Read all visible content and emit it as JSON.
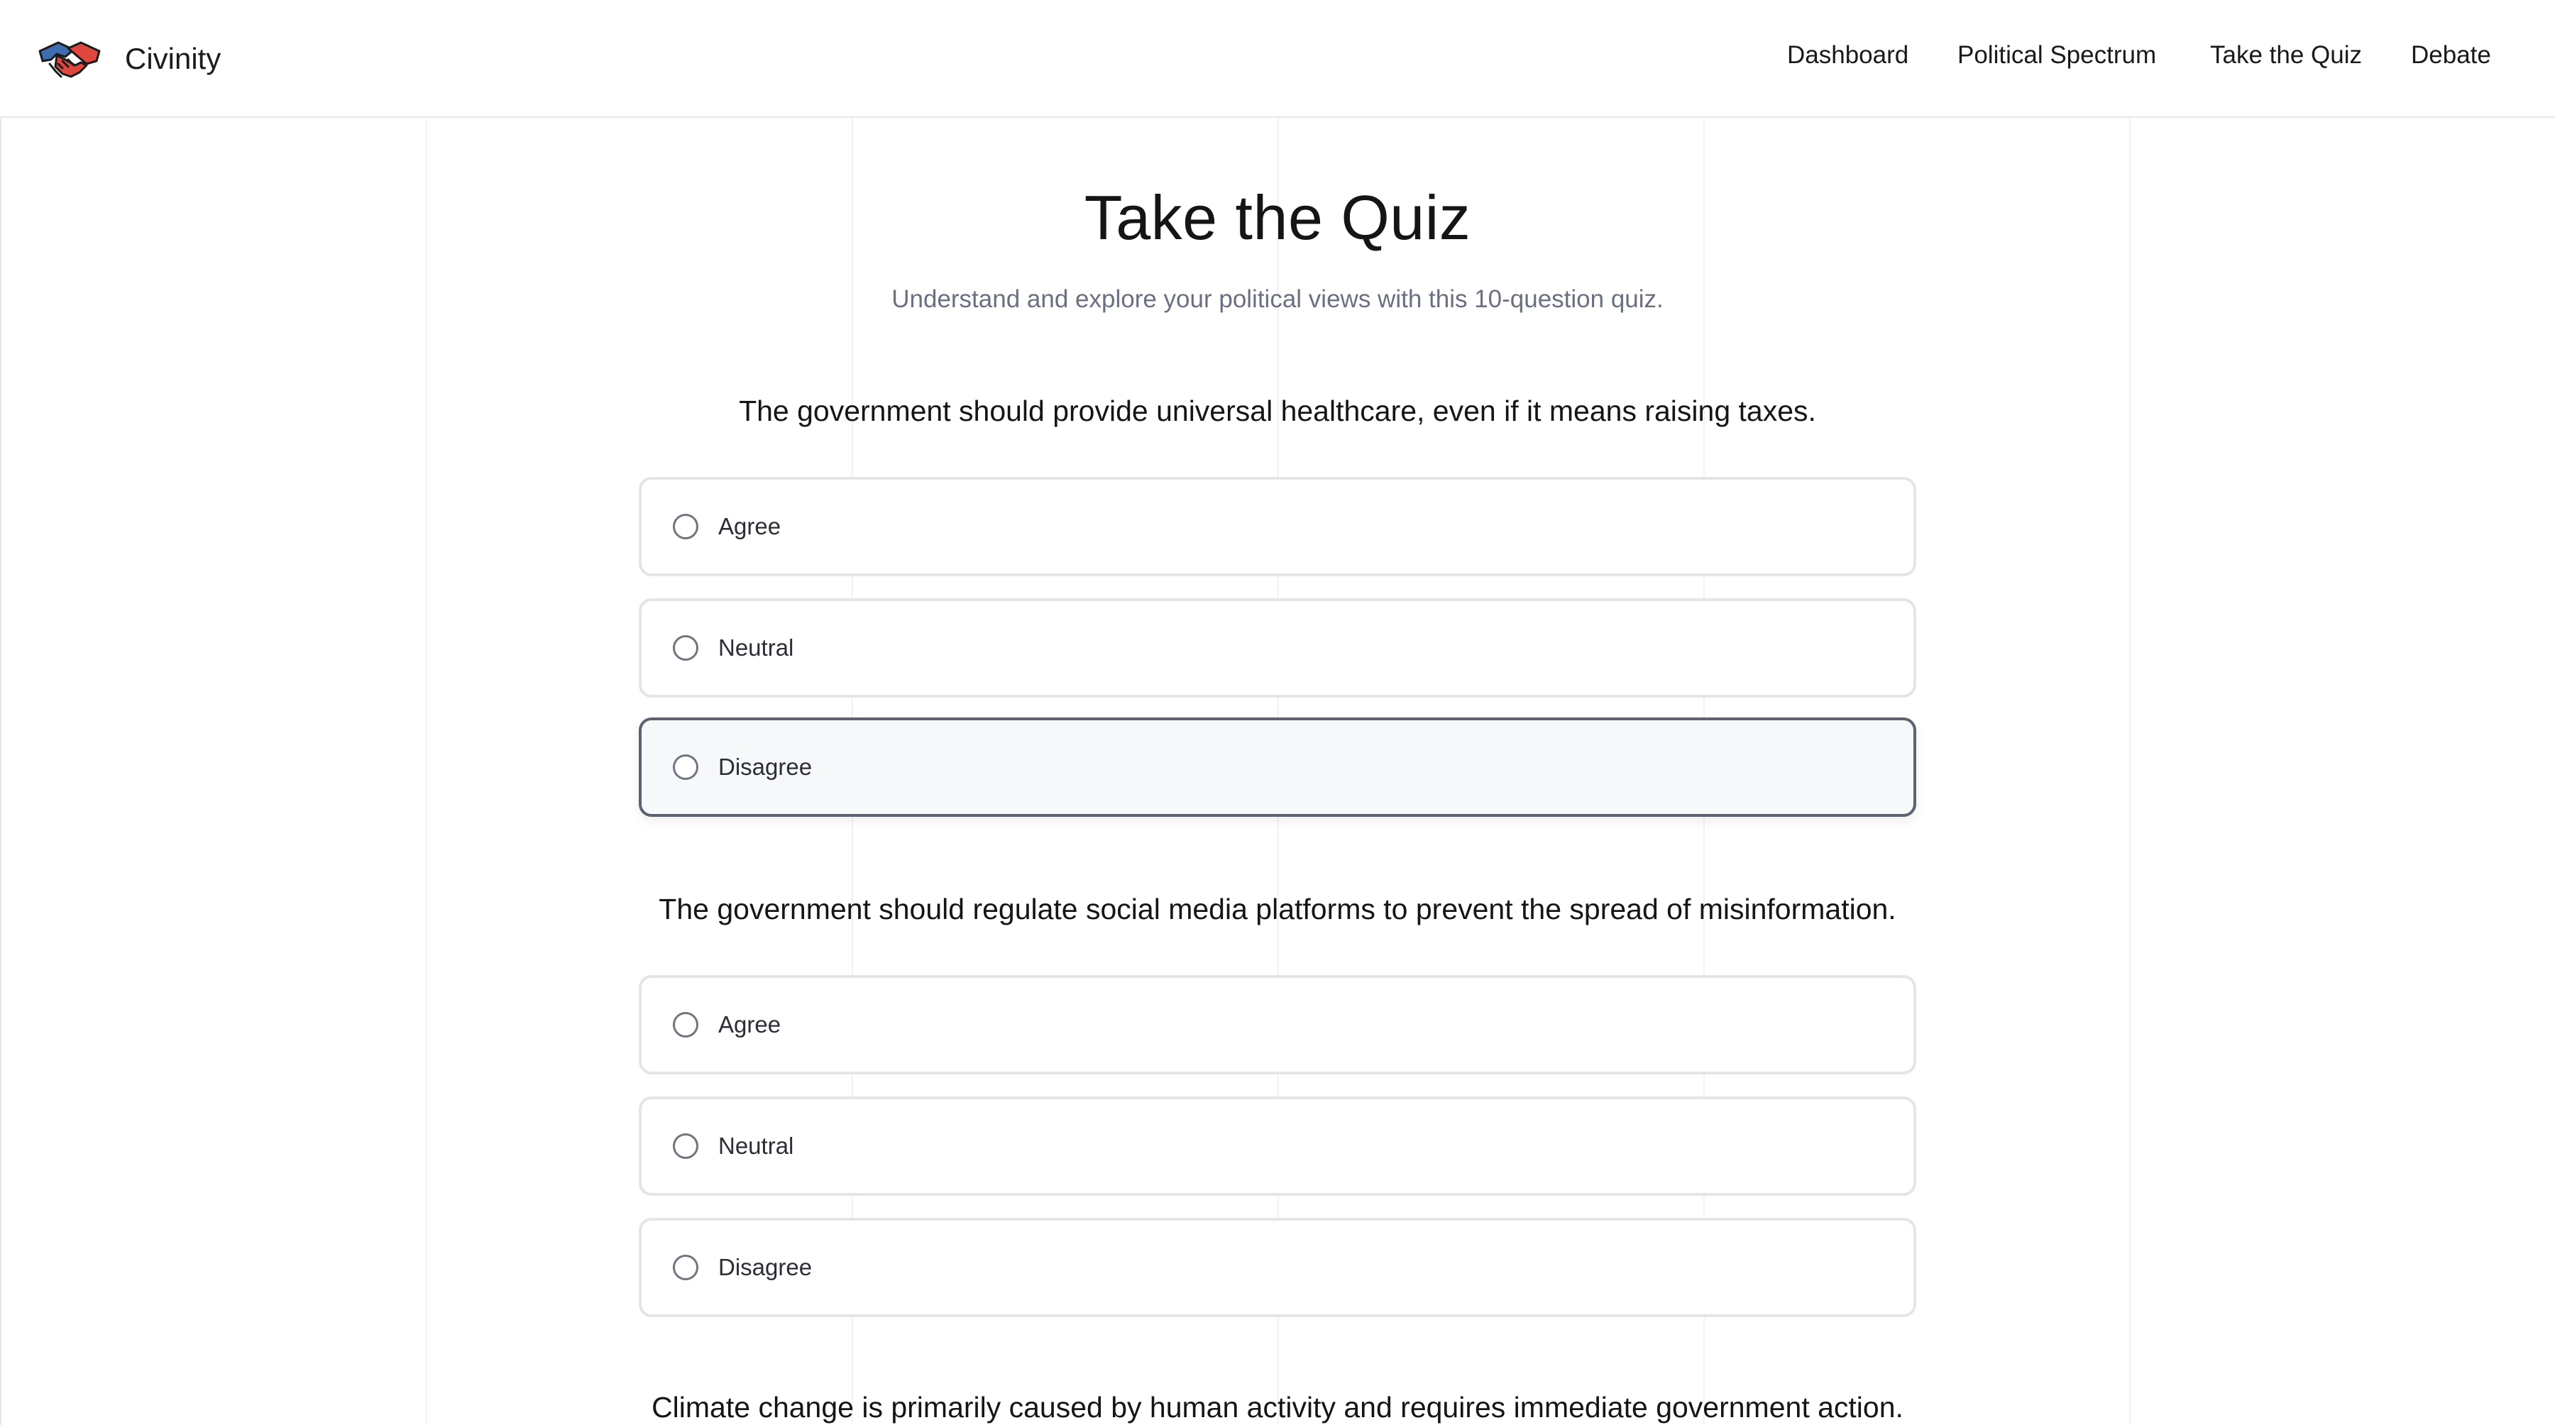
{
  "header": {
    "logo_icon": "handshake-icon",
    "brand": "Civinity",
    "nav": [
      "Dashboard",
      "Political Spectrum",
      "Take the Quiz",
      "Debate"
    ]
  },
  "main": {
    "title": "Take the Quiz",
    "subtitle": "Understand and explore your political views with this 10-question quiz.",
    "questions": [
      {
        "text": "The government should provide universal healthcare, even if it means raising taxes.",
        "options": [
          "Agree",
          "Neutral",
          "Disagree"
        ],
        "highlighted": "Disagree"
      },
      {
        "text": "The government should regulate social media platforms to prevent the spread of misinformation.",
        "options": [
          "Agree",
          "Neutral",
          "Disagree"
        ]
      },
      {
        "text": "Climate change is primarily caused by human activity and requires immediate government action."
      }
    ]
  },
  "colors": {
    "logo_red": "#e0473c",
    "logo_blue": "#3f6cb0",
    "subtitle": "#6b7080",
    "option_border": "#e4e5e8",
    "option_selected_border": "#5c6270"
  }
}
